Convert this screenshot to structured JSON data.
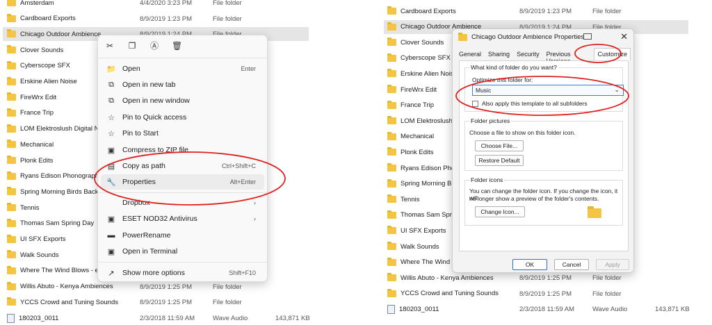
{
  "left_list": {
    "rows": [
      {
        "name": "Amsterdam",
        "date": "4/4/2020 3:23 PM",
        "type": "File folder"
      },
      {
        "name": "Cardboard Exports",
        "date": "8/9/2019 1:23 PM",
        "type": "File folder"
      },
      {
        "name": "Chicago Outdoor Ambience",
        "date": "8/9/2019 1:24 PM",
        "type": "File folder"
      },
      {
        "name": "Clover Sounds",
        "date": "",
        "type": ""
      },
      {
        "name": "Cyberscope SFX",
        "date": "",
        "type": ""
      },
      {
        "name": "Erskine Alien Noise",
        "date": "",
        "type": ""
      },
      {
        "name": "FireWrx Edit",
        "date": "",
        "type": ""
      },
      {
        "name": "France Trip",
        "date": "",
        "type": ""
      },
      {
        "name": "LOM Elektroslush Digital Noise",
        "date": "",
        "type": ""
      },
      {
        "name": "Mechanical",
        "date": "",
        "type": ""
      },
      {
        "name": "Plonk Edits",
        "date": "",
        "type": ""
      },
      {
        "name": "Ryans Edison Phonograph",
        "date": "",
        "type": ""
      },
      {
        "name": "Spring Morning Birds Backyard",
        "date": "",
        "type": ""
      },
      {
        "name": "Tennis",
        "date": "",
        "type": ""
      },
      {
        "name": "Thomas Sam Spring Day",
        "date": "",
        "type": ""
      },
      {
        "name": "UI SFX Exports",
        "date": "",
        "type": ""
      },
      {
        "name": "Walk Sounds",
        "date": "",
        "type": ""
      },
      {
        "name": "Where The Wind Blows - extra",
        "date": "",
        "type": ""
      },
      {
        "name": "Willis Abuto - Kenya Ambiences",
        "date": "8/9/2019 1:25 PM",
        "type": "File folder"
      },
      {
        "name": "YCCS Crowd and Tuning Sounds",
        "date": "8/9/2019 1:25 PM",
        "type": "File folder"
      },
      {
        "name": "180203_0011",
        "date": "2/3/2018 11:59 AM",
        "type": "Wave Audio",
        "size": "143,871 KB"
      }
    ]
  },
  "context_menu": {
    "items": [
      {
        "label": "Open",
        "shortcut": "Enter"
      },
      {
        "label": "Open in new tab",
        "shortcut": ""
      },
      {
        "label": "Open in new window",
        "shortcut": ""
      },
      {
        "label": "Pin to Quick access",
        "shortcut": ""
      },
      {
        "label": "Pin to Start",
        "shortcut": ""
      },
      {
        "label": "Compress to ZIP file",
        "shortcut": ""
      },
      {
        "label": "Copy as path",
        "shortcut": "Ctrl+Shift+C"
      },
      {
        "label": "Properties",
        "shortcut": "Alt+Enter"
      },
      {
        "label": "Dropbox",
        "shortcut": "›"
      },
      {
        "label": "ESET NOD32 Antivirus",
        "shortcut": "›"
      },
      {
        "label": "PowerRename",
        "shortcut": ""
      },
      {
        "label": "Open in Terminal",
        "shortcut": ""
      },
      {
        "label": "Show more options",
        "shortcut": "Shift+F10"
      }
    ]
  },
  "right_list": {
    "rows": [
      {
        "name": "Cardboard Exports",
        "date": "8/9/2019 1:23 PM",
        "type": "File folder"
      },
      {
        "name": "Chicago Outdoor Ambience",
        "date": "8/9/2019 1:24 PM",
        "type": "File folder"
      },
      {
        "name": "Clover Sounds",
        "date": "",
        "type": ""
      },
      {
        "name": "Cyberscope SFX",
        "date": "",
        "type": ""
      },
      {
        "name": "Erskine Alien Noise",
        "date": "",
        "type": ""
      },
      {
        "name": "FireWrx Edit",
        "date": "",
        "type": ""
      },
      {
        "name": "France Trip",
        "date": "",
        "type": ""
      },
      {
        "name": "LOM Elektroslush Di",
        "date": "",
        "type": ""
      },
      {
        "name": "Mechanical",
        "date": "",
        "type": ""
      },
      {
        "name": "Plonk Edits",
        "date": "",
        "type": ""
      },
      {
        "name": "Ryans Edison Phono",
        "date": "",
        "type": ""
      },
      {
        "name": "Spring Morning Birds",
        "date": "",
        "type": ""
      },
      {
        "name": "Tennis",
        "date": "",
        "type": ""
      },
      {
        "name": "Thomas Sam Spring",
        "date": "",
        "type": ""
      },
      {
        "name": "UI SFX Exports",
        "date": "",
        "type": ""
      },
      {
        "name": "Walk Sounds",
        "date": "",
        "type": ""
      },
      {
        "name": "Where The Wind Blo",
        "date": "",
        "type": ""
      },
      {
        "name": "Willis Abuto - Kenya Ambiences",
        "date": "8/9/2019 1:25 PM",
        "type": "File folder"
      },
      {
        "name": "YCCS Crowd and Tuning Sounds",
        "date": "8/9/2019 1:25 PM",
        "type": "File folder"
      },
      {
        "name": "180203_0011",
        "date": "2/3/2018 11:59 AM",
        "type": "Wave Audio",
        "size": "143,871 KB"
      }
    ]
  },
  "dialog": {
    "title": "Chicago Outdoor Ambience Properties",
    "close": "✕",
    "tabs": [
      "General",
      "Sharing",
      "Security",
      "Previous Versions",
      "Customize"
    ],
    "q_folder_type": "What kind of folder do you want?",
    "optimize_label": "Optimize this folder for:",
    "optimize_value": "Music",
    "apply_subfolders": "Also apply this template to all subfolders",
    "pictures_group": "Folder pictures",
    "pictures_desc": "Choose a file to show on this folder icon.",
    "choose_file": "Choose File...",
    "restore_default": "Restore Default",
    "icons_group": "Folder icons",
    "icons_desc_1": "You can change the folder icon. If you change the icon, it will",
    "icons_desc_2": "no longer show a preview of the folder's contents.",
    "change_icon": "Change Icon...",
    "ok": "OK",
    "cancel": "Cancel",
    "apply": "Apply"
  },
  "colors": {
    "annotation": "#e02020",
    "accent": "#2b6fcf",
    "folder": "#f4c542"
  }
}
